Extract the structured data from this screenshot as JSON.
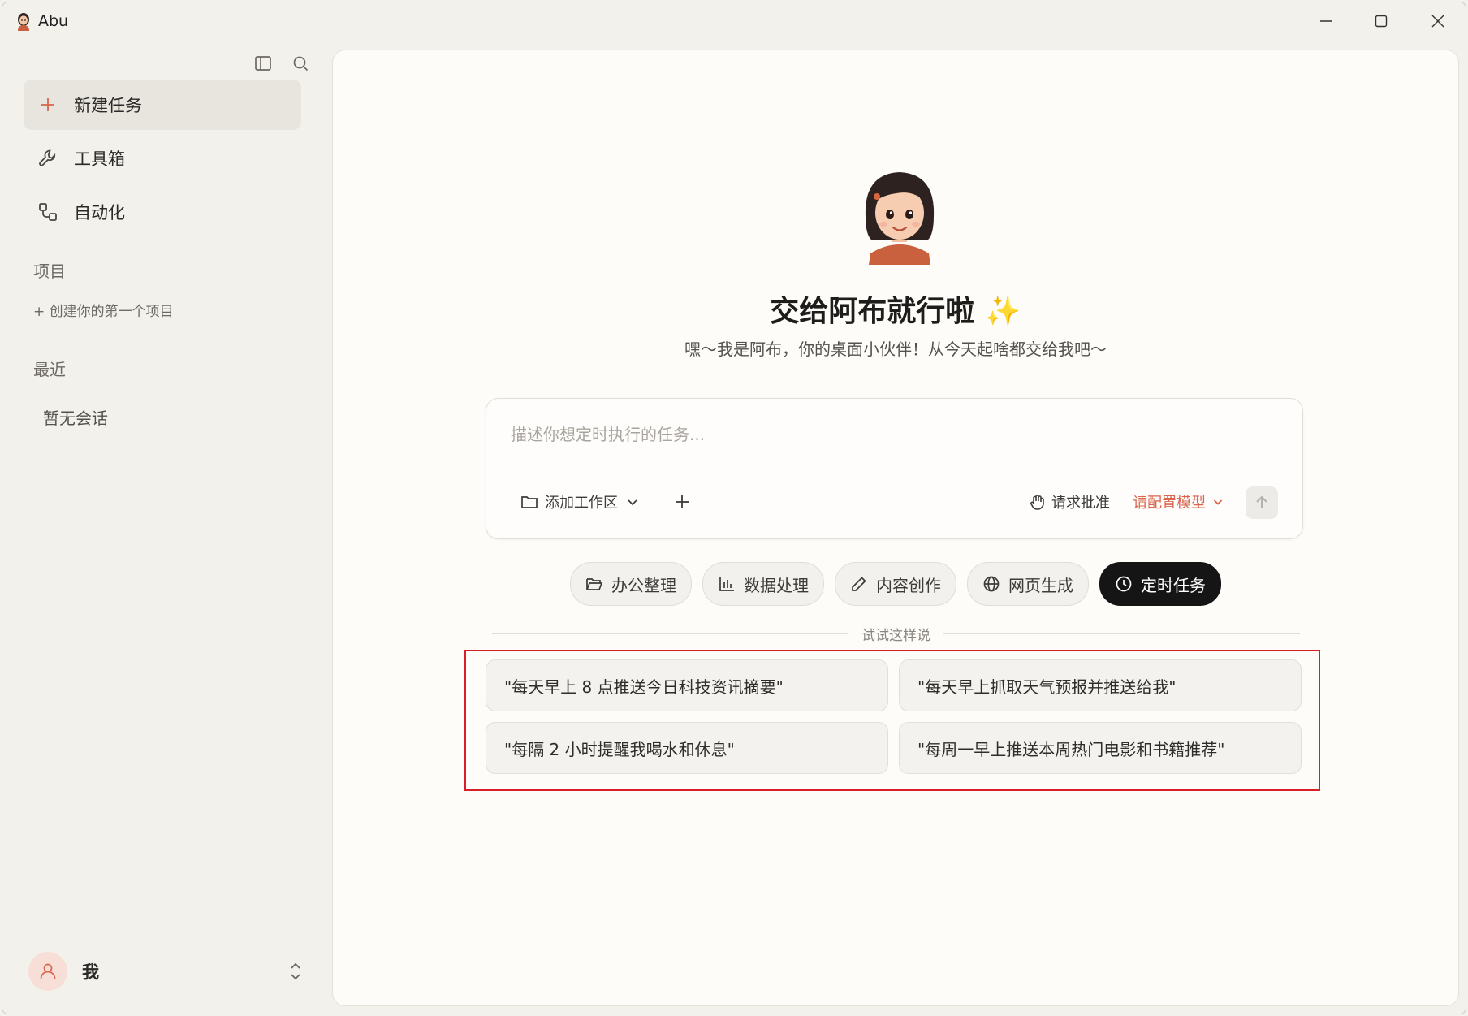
{
  "window": {
    "title": "Abu",
    "controls": [
      "minimize-icon",
      "maximize-icon",
      "close-icon"
    ]
  },
  "sidebar": {
    "tools": [
      "sidebar-toggle-icon",
      "search-icon"
    ],
    "nav": [
      {
        "label": "新建任务",
        "icon": "plus-icon",
        "active": true
      },
      {
        "label": "工具箱",
        "icon": "wrench-icon",
        "active": false
      },
      {
        "label": "自动化",
        "icon": "workflow-icon",
        "active": false
      }
    ],
    "projects_label": "项目",
    "create_project": "+ 创建你的第一个项目",
    "recent_label": "最近",
    "recent_empty": "暂无会话",
    "user": {
      "name": "我",
      "icon": "user-icon",
      "caret": "chevron-up-down-icon"
    }
  },
  "main": {
    "headline": "交给阿布就行啦",
    "headline_emoji": "✨",
    "subline": "嘿～我是阿布，你的桌面小伙伴！从今天起啥都交给我吧～",
    "composer": {
      "placeholder": "描述你想定时执行的任务...",
      "workspace_label": "添加工作区",
      "approve_label": "请求批准",
      "model_label": "请配置模型"
    },
    "categories": [
      {
        "label": "办公整理",
        "icon": "folder-open-icon",
        "active": false
      },
      {
        "label": "数据处理",
        "icon": "bar-chart-icon",
        "active": false
      },
      {
        "label": "内容创作",
        "icon": "pencil-icon",
        "active": false
      },
      {
        "label": "网页生成",
        "icon": "globe-icon",
        "active": false
      },
      {
        "label": "定时任务",
        "icon": "clock-icon",
        "active": true
      }
    ],
    "suggestions_title": "试试这样说",
    "suggestions": [
      "\"每天早上 8 点推送今日科技资讯摘要\"",
      "\"每天早上抓取天气预报并推送给我\"",
      "\"每隔 2 小时提醒我喝水和休息\"",
      "\"每周一早上推送本周热门电影和书籍推荐\""
    ]
  },
  "colors": {
    "accent": "#d9664d",
    "highlight_frame": "#d61f26",
    "active_chip": "#151515",
    "sidebar_bg": "#f3f1ec",
    "panel_bg": "#fdfcf9"
  }
}
